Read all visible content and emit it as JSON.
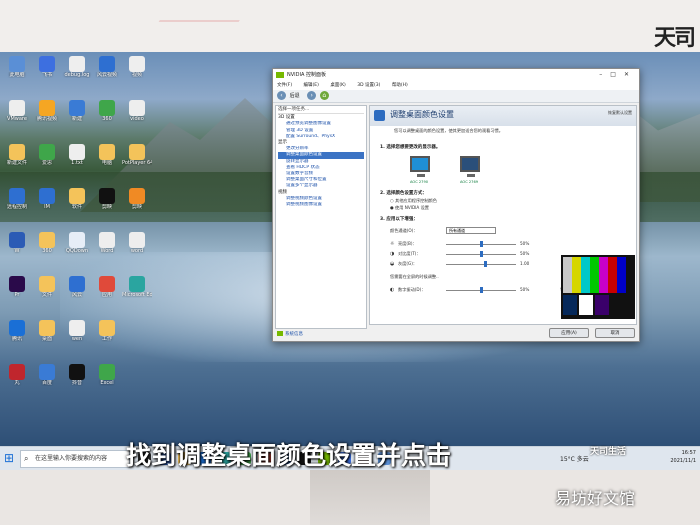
{
  "top_logo": "天司",
  "desktop_icons": [
    {
      "label": "此电脑",
      "color": "#5a8fd6"
    },
    {
      "label": "VMware",
      "color": "#eeeeee"
    },
    {
      "label": "新建文件",
      "color": "#f4c35a"
    },
    {
      "label": "远程控制",
      "color": "#2e6fd1"
    },
    {
      "label": "W",
      "color": "#2b5bb5"
    },
    {
      "label": "Pr",
      "color": "#2a0a4a"
    },
    {
      "label": "腾讯",
      "color": "#1a6fd6"
    },
    {
      "label": "丸",
      "color": "#c0262d"
    },
    {
      "label": "飞书",
      "color": "#3d6fe0"
    },
    {
      "label": "腾讯视频",
      "color": "#f5a623"
    },
    {
      "label": "爱思",
      "color": "#3fa64a"
    },
    {
      "label": "IM",
      "color": "#2e6fd1"
    },
    {
      "label": "360",
      "color": "#f4c35a"
    },
    {
      "label": "文件",
      "color": "#f4c35a"
    },
    {
      "label": "桌面",
      "color": "#f4c35a"
    },
    {
      "label": "百度",
      "color": "#3a7bd5"
    },
    {
      "label": "debug.log",
      "color": "#eeeeee"
    },
    {
      "label": "新建",
      "color": "#3a7bd5"
    },
    {
      "label": "1.txt",
      "color": "#eeeeee"
    },
    {
      "label": "软件",
      "color": "#f4c35a"
    },
    {
      "label": "QQDown",
      "color": "#e7eef7"
    },
    {
      "label": "风云",
      "color": "#2e6fd1"
    },
    {
      "label": "wen",
      "color": "#eeeeee"
    },
    {
      "label": "抖音",
      "color": "#111111"
    },
    {
      "label": "风云视频",
      "color": "#2e6fd1"
    },
    {
      "label": "360",
      "color": "#3fa64a"
    },
    {
      "label": "电脑",
      "color": "#f4c35a"
    },
    {
      "label": "剪映",
      "color": "#111111"
    },
    {
      "label": "Word",
      "color": "#eeeeee"
    },
    {
      "label": "应用",
      "color": "#e04a3a"
    },
    {
      "label": "工作",
      "color": "#f4c35a"
    },
    {
      "label": "Excel",
      "color": "#3fa64a"
    },
    {
      "label": "视频",
      "color": "#eeeeee"
    },
    {
      "label": "video",
      "color": "#eeeeee"
    },
    {
      "label": "PotPlayer 64 bit",
      "color": "#f4c35a"
    },
    {
      "label": "剪映",
      "color": "#f08a24"
    },
    {
      "label": "word",
      "color": "#eeeeee"
    },
    {
      "label": "Microsoft Edge",
      "color": "#2aa5a0"
    }
  ],
  "taskbar": {
    "search_placeholder": "在这里输入你要搜索的内容",
    "weather": "15°C 多云",
    "time": "16:57",
    "date": "2021/11/1"
  },
  "nvidia": {
    "title": "NVIDIA 控制面板",
    "menu": [
      "文件(F)",
      "编辑(E)",
      "桌面(K)",
      "3D 设置(3)",
      "帮助(H)"
    ],
    "toolbar_back": "后退",
    "toolbar_home": "⌂",
    "task_header": "选择一项任务...",
    "tree": [
      {
        "type": "group",
        "label": "3D 设置"
      },
      {
        "type": "item",
        "label": "通过预览调整图像设置"
      },
      {
        "type": "item",
        "label": "管理 3D 设置"
      },
      {
        "type": "item",
        "label": "配置 Surround、PhysX"
      },
      {
        "type": "group",
        "label": "显示"
      },
      {
        "type": "item",
        "label": "更改分辨率"
      },
      {
        "type": "item",
        "label": "调整桌面颜色设置",
        "selected": true
      },
      {
        "type": "item",
        "label": "旋转显示器"
      },
      {
        "type": "item",
        "label": "查看 HDCP 状态"
      },
      {
        "type": "item",
        "label": "设置数字音频"
      },
      {
        "type": "item",
        "label": "调整桌面尺寸和位置"
      },
      {
        "type": "item",
        "label": "设置多个显示器"
      },
      {
        "type": "group",
        "label": "视频"
      },
      {
        "type": "item",
        "label": "调整视频颜色设置"
      },
      {
        "type": "item",
        "label": "调整视频图像设置"
      }
    ],
    "system_info": "系统信息",
    "page_title": "调整桌面颜色设置",
    "restore": "恢复默认设置",
    "description": "您可以调整桌面的颜色设置，使其更加适合您的观看习惯。",
    "section1": "1. 选择您想要更改的显示器。",
    "monitors": [
      "AOC 2790",
      "AOC 2769"
    ],
    "section2": "2. 选择颜色设置方式：",
    "radio_default": "其他应用程序控制颜色",
    "radio_nvidia": "使用 NVIDIA 设置",
    "section3": "3. 应用以下增强：",
    "channel_label": "颜色通道(O)：",
    "channel_value": "所有通道",
    "sliders": [
      {
        "name": "亮度(B)：",
        "value": "50%",
        "pos": 0.5
      },
      {
        "name": "对比度(T)：",
        "value": "50%",
        "pos": 0.5
      },
      {
        "name": "灰度(G)：",
        "value": "1.00",
        "pos": 0.55
      }
    ],
    "digital_label": "数字振动(D)：",
    "digital_value": "50%",
    "note": "您需要在全屏的时候调整..",
    "apply": "应用(A)",
    "cancel": "取消",
    "zoom_label": "参考图像："
  },
  "subtitle": "找到调整桌面颜色设置并点击",
  "brand": "天司生活",
  "watermark": "易坊好文馆"
}
